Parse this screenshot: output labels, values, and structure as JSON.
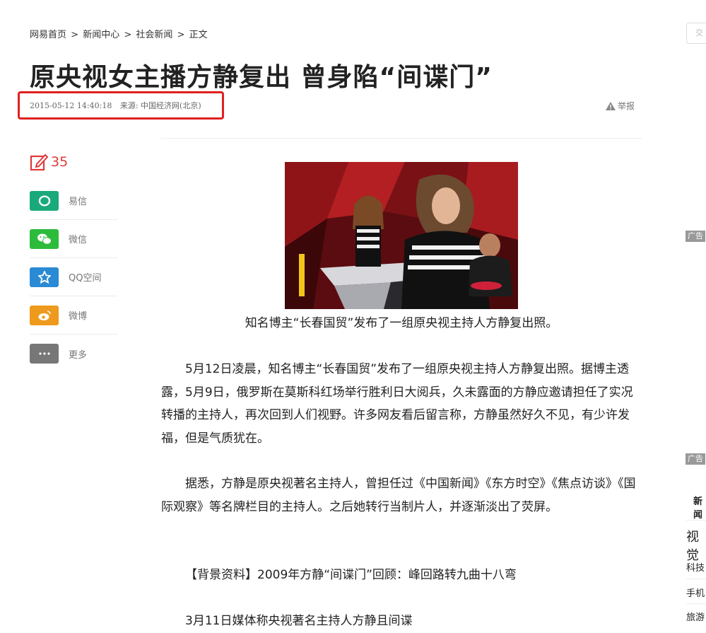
{
  "breadcrumb": {
    "home": "网易首页",
    "sep1": " > ",
    "news": "新闻中心",
    "sep2": " > ",
    "social": "社会新闻",
    "sep3": " > ",
    "current": "正文"
  },
  "article": {
    "title": "原央视女主播方静复出 曾身陷“间谍门”",
    "datetime": "2015-05-12 14:40:18",
    "source": "来源: 中国经济网(北京)",
    "report_label": "举报",
    "caption": "知名博主“长春国贸”发布了一组原央视主持人方静复出照。",
    "paragraphs": [
      "5月12日凌晨，知名博主“长春国贸”发布了一组原央视主持人方静复出照。据博主透露，5月9日，俄罗斯在莫斯科红场举行胜利日大阅兵，久未露面的方静应邀请担任了实况转播的主持人，再次回到人们视野。许多网友看后留言称，方静虽然好久不见，有少许发福，但是气质犹在。",
      "据悉，方静是原央视著名主持人，曾担任过《中国新闻》《东方时空》《焦点访谈》《国际观察》等名牌栏目的主持人。之后她转行当制片人，并逐渐淡出了荧屏。",
      "【背景资料】2009年方静“间谍门”回顾：峰回路转九曲十八弯",
      "3月11日媒体称央视著名主持人方静且间谍"
    ]
  },
  "share": {
    "comment_count": "35",
    "items": [
      {
        "label": "易信",
        "icon": "yixin-icon",
        "color": "#1aa97b"
      },
      {
        "label": "微信",
        "icon": "wechat-icon",
        "color": "#2dbb3c"
      },
      {
        "label": "QQ空间",
        "icon": "qzone-icon",
        "color": "#2a8ad4"
      },
      {
        "label": "微博",
        "icon": "weibo-icon",
        "color": "#ee9a1c"
      },
      {
        "label": "更多",
        "icon": "more-icon",
        "color": "#777777"
      }
    ]
  },
  "sidebar": {
    "search_placeholder": "交",
    "ad_label": "广告",
    "tab": "新闻",
    "heading": "视觉",
    "links": [
      "科技",
      "手机",
      "旅游"
    ]
  },
  "colors": {
    "highlight": "#e02020",
    "comment": "#e03a3a"
  }
}
